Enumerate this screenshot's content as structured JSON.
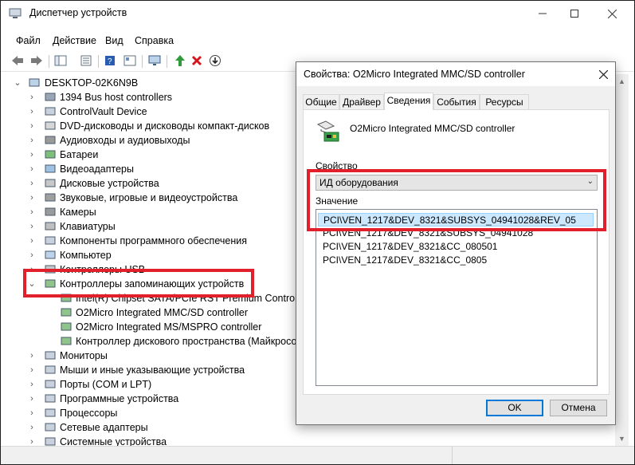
{
  "window": {
    "title": "Диспетчер устройств"
  },
  "menu": [
    "Файл",
    "Действие",
    "Вид",
    "Справка"
  ],
  "tree": {
    "root": "DESKTOP-02K6N9B",
    "items": [
      {
        "label": "1394 Bus host controllers",
        "icon": "bus-icon"
      },
      {
        "label": "ControlVault Device",
        "icon": "device-icon"
      },
      {
        "label": "DVD-дисководы и дисководы компакт-дисков",
        "icon": "dvd-icon"
      },
      {
        "label": "Аудиовходы и аудиовыходы",
        "icon": "audio-icon"
      },
      {
        "label": "Батареи",
        "icon": "battery-icon"
      },
      {
        "label": "Видеоадаптеры",
        "icon": "display-adapter-icon"
      },
      {
        "label": "Дисковые устройства",
        "icon": "disk-icon"
      },
      {
        "label": "Звуковые, игровые и видеоустройства",
        "icon": "speaker-icon"
      },
      {
        "label": "Камеры",
        "icon": "camera-icon"
      },
      {
        "label": "Клавиатуры",
        "icon": "keyboard-icon"
      },
      {
        "label": "Компоненты программного обеспечения",
        "icon": "software-icon"
      },
      {
        "label": "Компьютер",
        "icon": "computer-icon"
      },
      {
        "label": "Контроллеры USB",
        "icon": "usb-icon"
      },
      {
        "label": "Контроллеры запоминающих устройств",
        "icon": "storage-controller-icon"
      }
    ],
    "children": [
      "Intel(R) Chipset SATA/PCIe RST Premium Controller",
      "O2Micro Integrated MMC/SD controller",
      "O2Micro Integrated MS/MSPRO controller",
      "Контроллер дискового пространства (Майкрософт)"
    ],
    "after": [
      {
        "label": "Мониторы",
        "icon": "monitor-icon"
      },
      {
        "label": "Мыши и иные указывающие устройства",
        "icon": "mouse-icon"
      },
      {
        "label": "Порты (COM и LPT)",
        "icon": "port-icon"
      },
      {
        "label": "Программные устройства",
        "icon": "software-device-icon"
      },
      {
        "label": "Процессоры",
        "icon": "cpu-icon"
      },
      {
        "label": "Сетевые адаптеры",
        "icon": "network-icon"
      },
      {
        "label": "Системные устройства",
        "icon": "system-icon"
      }
    ]
  },
  "dialog": {
    "title": "Свойства: O2Micro Integrated MMC/SD controller",
    "tabs": [
      "Общие",
      "Драйвер",
      "Сведения",
      "События",
      "Ресурсы"
    ],
    "active_tab": "Сведения",
    "device_name": "O2Micro Integrated MMC/SD controller",
    "property_label": "Свойство",
    "property_value": "ИД оборудования",
    "value_label": "Значение",
    "values": [
      "PCI\\VEN_1217&DEV_8321&SUBSYS_04941028&REV_05",
      "PCI\\VEN_1217&DEV_8321&SUBSYS_04941028",
      "PCI\\VEN_1217&DEV_8321&CC_080501",
      "PCI\\VEN_1217&DEV_8321&CC_0805"
    ],
    "ok_label": "OK",
    "cancel_label": "Отмена"
  },
  "colors": {
    "highlight": "#e2202c",
    "selection": "#cce8ff",
    "accent": "#0078d7"
  }
}
